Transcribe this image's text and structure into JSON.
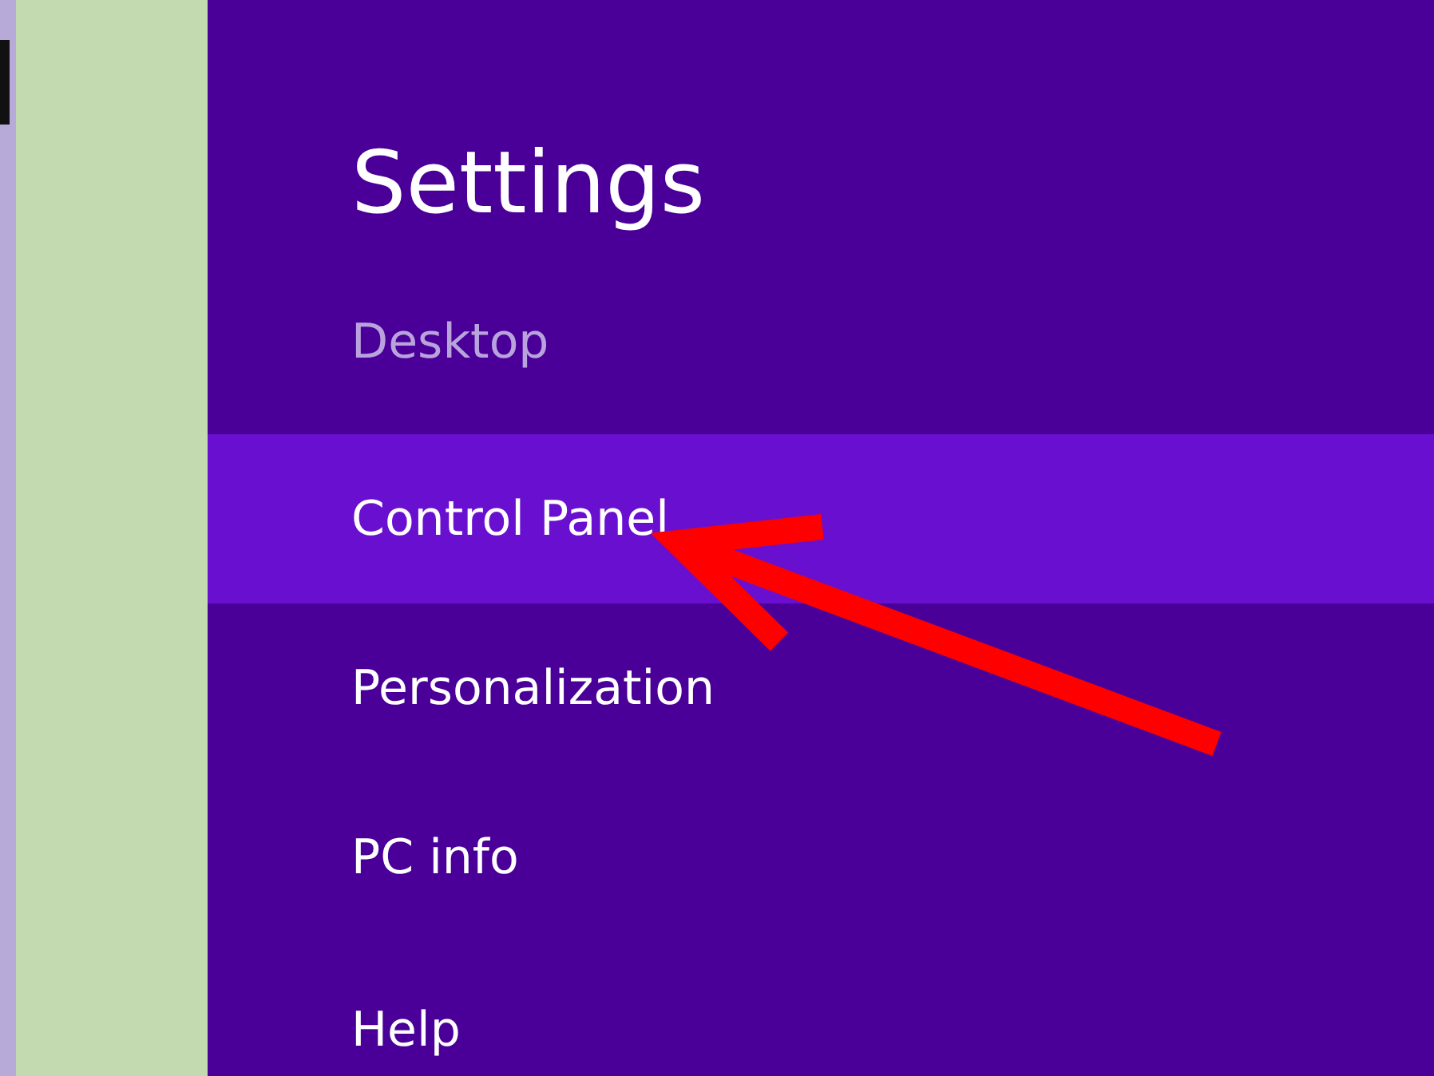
{
  "settings": {
    "title": "Settings",
    "section": "Desktop",
    "items": [
      {
        "label": "Control Panel",
        "selected": true
      },
      {
        "label": "Personalization",
        "selected": false
      },
      {
        "label": "PC info",
        "selected": false
      },
      {
        "label": "Help",
        "selected": false
      }
    ]
  }
}
